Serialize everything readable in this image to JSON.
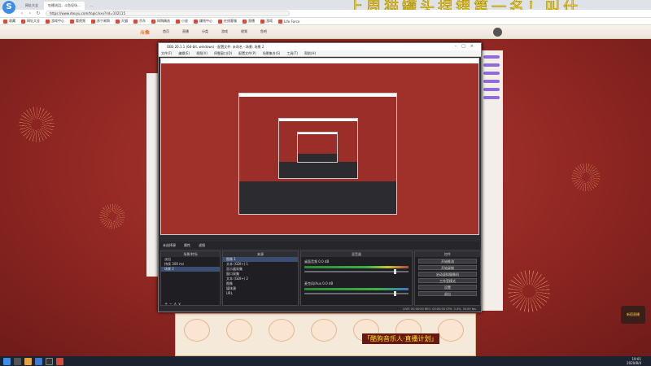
{
  "browser": {
    "tabs": [
      "网址大全",
      "吃播流泪，斗鱼现场...",
      "..."
    ],
    "url": "https://www.douyu.com/topic/xxx?rid=102115",
    "bookmarks": [
      "收藏",
      "网址大全",
      "游戏中心",
      "看视频",
      "苏宁易购",
      "天猫",
      "京东",
      "网购精选",
      "小说",
      "赚钱中心",
      "在线客服",
      "直播",
      "游戏",
      "Life Force"
    ]
  },
  "overlay_title": "上周猫罐头捏锂第一名！叫什",
  "site": {
    "logo": "斗鱼",
    "nav": [
      "首页",
      "直播",
      "分类",
      "游戏",
      "视频",
      "鱼吧"
    ]
  },
  "badge": "翻",
  "obs": {
    "title": "OBS 26.1.1 (64-bit, windows) - 配置文件: 未命名 - 场景: 场景 2",
    "menu": [
      "文件(F)",
      "编辑(E)",
      "视图(V)",
      "停靠窗口(D)",
      "配置文件(P)",
      "场景集合(S)",
      "工具(T)",
      "帮助(H)"
    ],
    "scene_bar": [
      "未选择源",
      "属性",
      "滤镜"
    ],
    "docks": {
      "scenes_header": "场景/转场",
      "scenes": [
        "淡出",
        "持续 300 ms",
        "场景 2"
      ],
      "sources_header": "来源",
      "sources": [
        "图像 1",
        "文本 (GDI+) 1",
        "显示器采集",
        "窗口采集",
        "文本 (GDI+) 2",
        "图像",
        "媒体源",
        "URL"
      ],
      "mixer_header": "混音器",
      "mixer": [
        {
          "name": "桌面音频",
          "db": "0.0 dB"
        },
        {
          "name": "麦克风/Aux",
          "db": "0.0 dB"
        }
      ],
      "controls_header": "控件",
      "controls": [
        "开始推流",
        "开始录制",
        "启动虚拟摄像机",
        "工作室模式",
        "设置",
        "退出"
      ]
    },
    "status": "LIVE: 00:00:00   REC: 00:00:00   CPU: 3.4%, 30.00 fps"
  },
  "ad_text": "「酷狗音乐人·直播计划」",
  "corner_label": "新宿直播",
  "clock": {
    "time": "19:01",
    "date": "2020/8/4"
  }
}
